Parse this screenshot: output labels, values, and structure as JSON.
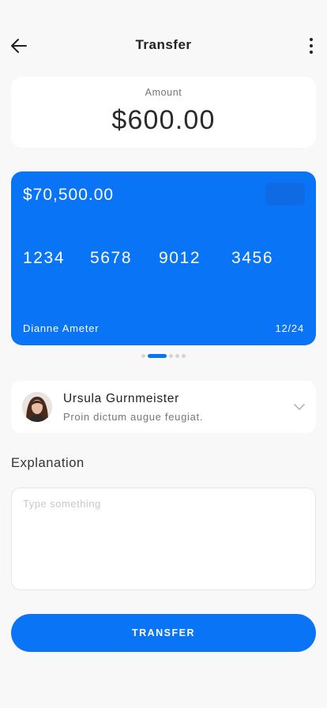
{
  "header": {
    "title": "Transfer",
    "back_icon": "arrow-left-icon",
    "more_icon": "more-vertical-icon"
  },
  "amount": {
    "label": "Amount",
    "value": "$600.00"
  },
  "card": {
    "balance": "$70,500.00",
    "number_groups": [
      "1234",
      "5678",
      "9012",
      "3456"
    ],
    "holder": "Dianne Ameter",
    "expiry": "12/24",
    "color": "#0a74f6"
  },
  "carousel": {
    "active_index": 1,
    "count": 5
  },
  "recipient": {
    "name": "Ursula Gurnmeister",
    "note": "Proin dictum augue feugiat.",
    "chevron_icon": "chevron-down-icon"
  },
  "explanation": {
    "label": "Explanation",
    "placeholder": "Type something",
    "value": ""
  },
  "actions": {
    "transfer_label": "TRANSFER"
  },
  "colors": {
    "accent": "#0a74f6",
    "background": "#f8f8f8",
    "surface": "#ffffff"
  }
}
